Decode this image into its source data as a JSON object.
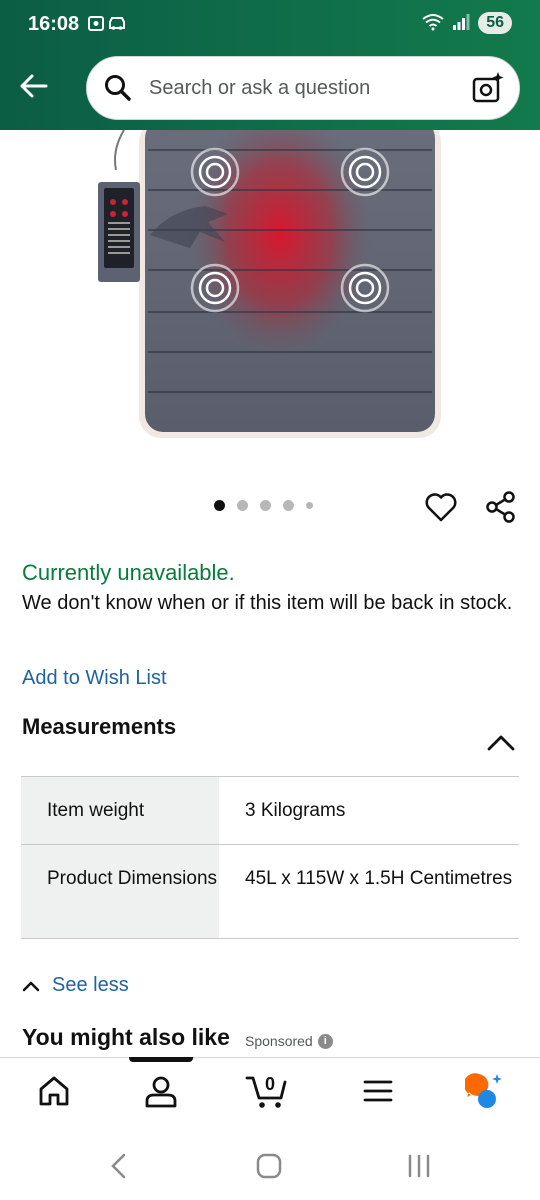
{
  "status_bar": {
    "time": "16:08",
    "battery": "56"
  },
  "search": {
    "placeholder": "Search or ask a question"
  },
  "carousel": {
    "total_dots": 5,
    "active_index": 0
  },
  "availability": {
    "status": "Currently unavailable.",
    "message": "We don't know when or if this item will be back in stock."
  },
  "wishlist_link": "Add to Wish List",
  "measurements": {
    "title": "Measurements",
    "rows": [
      {
        "label": "Item weight",
        "value": "3 Kilograms"
      },
      {
        "label": "Product Dimensions",
        "value": "45L x 115W x 1.5H Centimetres"
      }
    ]
  },
  "see_less": "See less",
  "also_like": {
    "title": "You might also like",
    "sponsored": "Sponsored"
  },
  "bottom_nav": {
    "cart_count": "0"
  },
  "colors": {
    "header_green": "#0f6b4a",
    "availability_green": "#067d3b",
    "link_blue": "#2162a1"
  }
}
